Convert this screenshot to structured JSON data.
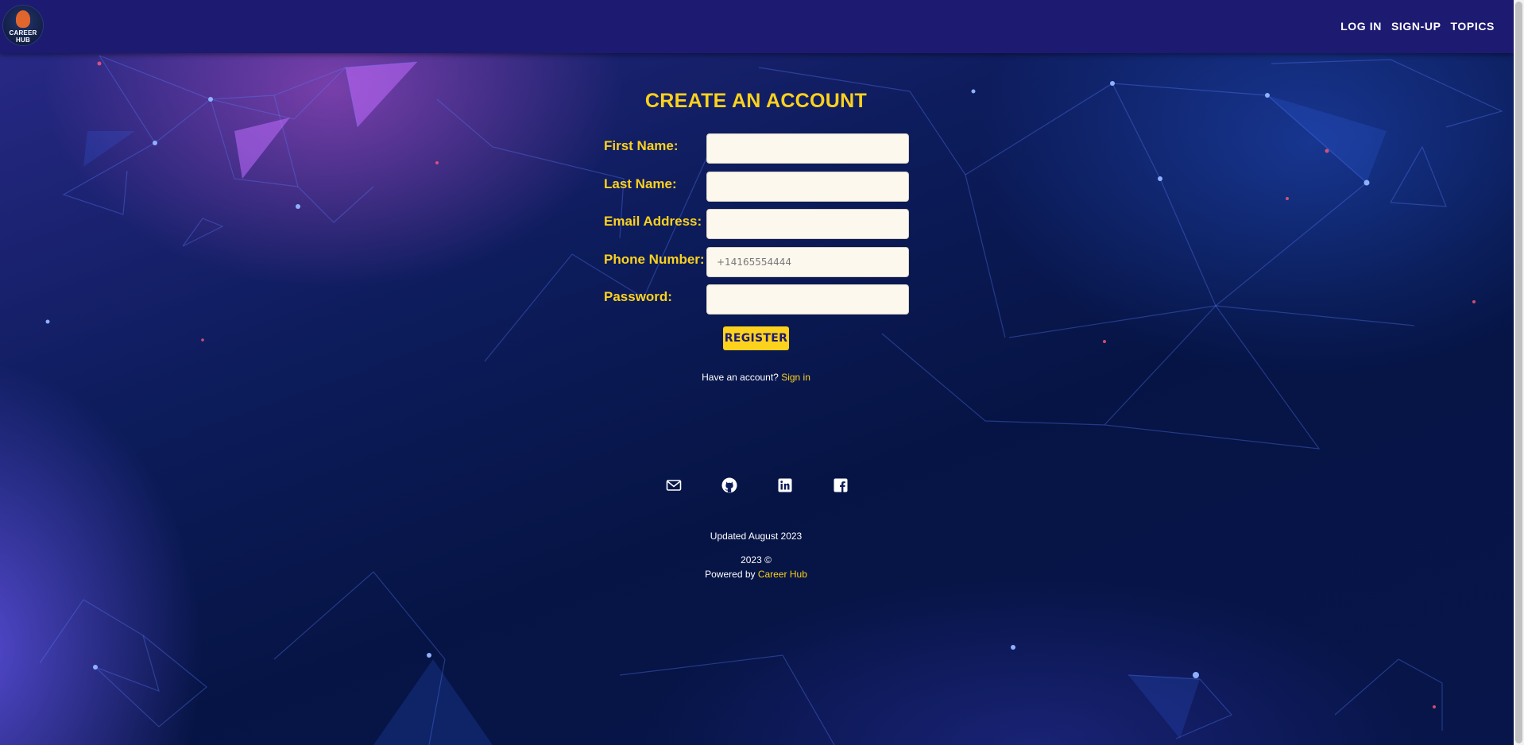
{
  "navbar": {
    "logo_text": "CAREER HUB",
    "links": [
      "LOG IN",
      "SIGN-UP",
      "TOPICS"
    ]
  },
  "form": {
    "title": "CREATE AN ACCOUNT",
    "fields": [
      {
        "label": "First Name:",
        "value": "",
        "placeholder": ""
      },
      {
        "label": "Last Name:",
        "value": "",
        "placeholder": ""
      },
      {
        "label": "Email Address:",
        "value": "",
        "placeholder": ""
      },
      {
        "label": "Phone Number:",
        "value": "",
        "placeholder": "+14165554444"
      },
      {
        "label": "Password:",
        "value": "",
        "placeholder": ""
      }
    ],
    "register_label": "REGISTER",
    "signin_prompt": "Have an account?",
    "signin_link": "Sign in"
  },
  "footer": {
    "social_icons": [
      "mail-icon",
      "github-icon",
      "linkedin-icon",
      "facebook-icon"
    ],
    "updated": "Updated August 2023",
    "copyright": "2023 ©",
    "powered_by": "Powered by",
    "brand": "Career Hub"
  },
  "colors": {
    "accent": "#fcd21d",
    "navbar": "#1d1a72",
    "input_bg": "#fdf8ee",
    "background": "#0d1c5c"
  }
}
